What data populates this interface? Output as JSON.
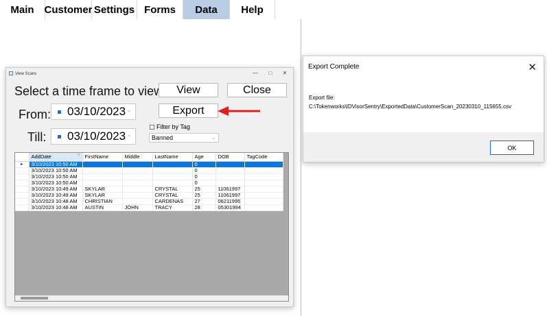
{
  "menu": {
    "items": [
      {
        "label": "Main"
      },
      {
        "label": "Customer"
      },
      {
        "label": "Settings"
      },
      {
        "label": "Forms"
      },
      {
        "label": "Data"
      },
      {
        "label": "Help"
      }
    ]
  },
  "view_scans": {
    "title": "View Scans",
    "prompt": "Select a time frame to view:",
    "view_label": "View",
    "close_label": "Close",
    "export_label": "Export",
    "from_label": "From:",
    "till_label": "Till:",
    "from_date": "03/10/2023",
    "till_date": "03/10/2023",
    "filter_label": "Filter by Tag",
    "tag_value": "Banned",
    "grid": {
      "columns": [
        "AddDate",
        "FirstName",
        "Middle",
        "LastName",
        "Age",
        "DOB",
        "TagCode"
      ],
      "rows": [
        [
          "3/10/2023 10:50 AM",
          "",
          "",
          "",
          "0",
          "",
          ""
        ],
        [
          "3/10/2023 10:50 AM",
          "",
          "",
          "",
          "0",
          "",
          ""
        ],
        [
          "3/10/2023 10:50 AM",
          "",
          "",
          "",
          "0",
          "",
          ""
        ],
        [
          "3/10/2023 10:50 AM",
          "",
          "",
          "",
          "0",
          "",
          ""
        ],
        [
          "3/10/2023 10:49 AM",
          "SKYLAR",
          "",
          "CRYSTAL",
          "25",
          "11061997",
          ""
        ],
        [
          "3/10/2023 10:49 AM",
          "SKYLAR",
          "",
          "CRYSTAL",
          "25",
          "11061997",
          ""
        ],
        [
          "3/10/2023 10:48 AM",
          "CHRISTIAN",
          "",
          "CARDENAS",
          "27",
          "06211995",
          ""
        ],
        [
          "3/10/2023 10:48 AM",
          "AUSTIN",
          "JOHN",
          "TRACY",
          "28",
          "05301994",
          ""
        ]
      ]
    }
  },
  "export_dialog": {
    "title": "Export Complete",
    "message_line1": "Export file:",
    "message_path": "C:\\Tokenworks\\IDVisorSentry\\ExportedData\\CustomerScan_20230310_115655.csv",
    "ok_label": "OK"
  },
  "colors": {
    "menu_active": "#b8cce4",
    "selection": "#0a78d7",
    "arrow": "#e02020"
  }
}
